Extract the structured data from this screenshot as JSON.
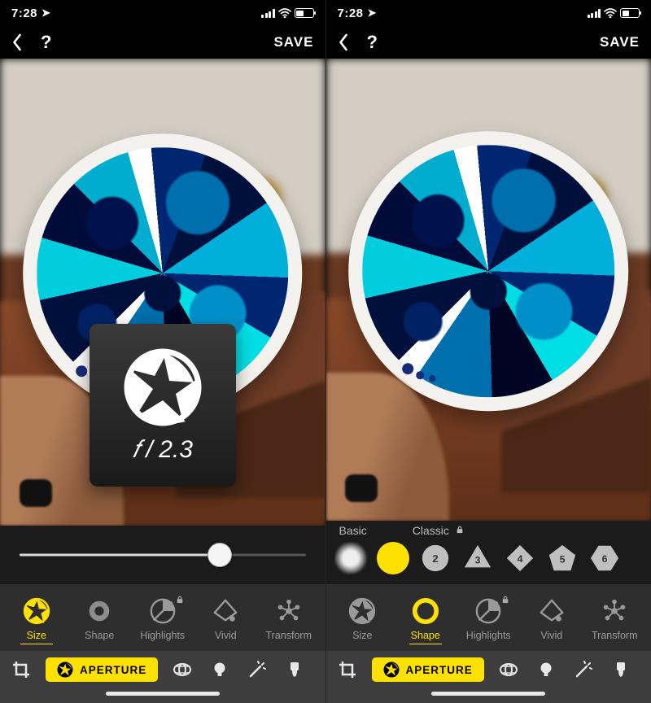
{
  "status": {
    "time": "7:28",
    "locglyph": "➤"
  },
  "topbar": {
    "help": "?",
    "save": "SAVE"
  },
  "aperture_card": {
    "f": "𝑓",
    "sep": "/",
    "value": "2.3"
  },
  "slider": {
    "pct": 70
  },
  "shape_groups": {
    "basic": "Basic",
    "classic": "Classic"
  },
  "shape_numbers": [
    "2",
    "3",
    "4",
    "5",
    "6"
  ],
  "tools": {
    "size": "Size",
    "shape": "Shape",
    "highlights": "Highlights",
    "vivid": "Vivid",
    "transform": "Transform"
  },
  "bottom": {
    "aperture": "APERTURE"
  }
}
